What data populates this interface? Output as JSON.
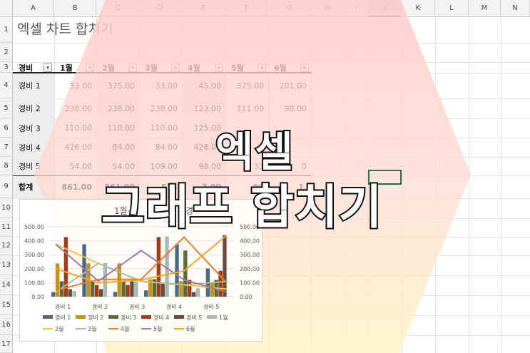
{
  "app": {
    "title": "엑셀 차트 합치기"
  },
  "columns": [
    "A",
    "B",
    "C",
    "D",
    "E",
    "F",
    "G",
    "H",
    "I",
    "J",
    "K",
    "L",
    "M",
    "N"
  ],
  "rows": [
    "1",
    "2",
    "3",
    "4",
    "5",
    "6",
    "7",
    "8",
    "9",
    "10",
    "11",
    "12",
    "13",
    "14",
    "15",
    "16",
    "17"
  ],
  "table": {
    "headers": [
      "경비",
      "1월",
      "2월",
      "3월",
      "4월",
      "5월",
      "6월"
    ],
    "rows": [
      {
        "label": "경비 1",
        "values": [
          "33.00",
          "375.00",
          "33.00",
          "45.00",
          "375.00",
          "201.00"
        ]
      },
      {
        "label": "경비 2",
        "values": [
          "238.00",
          "238.00",
          "238.00",
          "123.00",
          "111.00",
          "98.00"
        ]
      },
      {
        "label": "경비 3",
        "values": [
          "110.00",
          "110.00",
          "110.00",
          "125.00",
          "",
          ""
        ]
      },
      {
        "label": "경비 4",
        "values": [
          "426.00",
          "84.00",
          "84.00",
          "426.00",
          "",
          ""
        ]
      },
      {
        "label": "경비 5",
        "values": [
          "54.00",
          "54.00",
          "109.00",
          "98.00",
          "33",
          "0"
        ]
      }
    ],
    "total": {
      "label": "합계",
      "values": [
        "861.00",
        "861.00",
        "574",
        "7.00",
        "00",
        "1,"
      ]
    }
  },
  "overlay": {
    "line1": "엑셀",
    "line2": "그래프 합치기"
  },
  "colors": {
    "hex_top": "#ffd6d6",
    "hex_bottom": "#fff3c8",
    "excel_green": "#217346"
  },
  "chart_data": {
    "type": "bar",
    "title": "1월~",
    "title_partial": "경",
    "categories": [
      "경비 1",
      "경비 2",
      "경비 3",
      "경비 4",
      "경비 5"
    ],
    "ylim": [
      0,
      500
    ],
    "yticks_left": [
      "500.00",
      "400.00",
      "300.00",
      "200.00",
      "100.00",
      "0.00"
    ],
    "yticks_right": [
      "500.00",
      "400.00",
      "300.00",
      "200.00",
      "100.00",
      "0.00"
    ],
    "bar_series": [
      {
        "name": "경비 1",
        "color": "#4a6b82",
        "values": [
          33,
          375,
          33,
          45,
          375,
          201
        ]
      },
      {
        "name": "경비 2",
        "color": "#c69214",
        "values": [
          238,
          238,
          238,
          123,
          111,
          98
        ]
      },
      {
        "name": "경비 3",
        "color": "#5b6b3d",
        "values": [
          110,
          110,
          110,
          125,
          330,
          120
        ]
      },
      {
        "name": "경비 4",
        "color": "#a33e14",
        "values": [
          426,
          84,
          84,
          426,
          120,
          185
        ]
      },
      {
        "name": "경비 5",
        "color": "#6b4a40",
        "values": [
          54,
          54,
          109,
          98,
          33,
          440
        ]
      },
      {
        "name": "1월",
        "color": "#a6b9b2",
        "values": [
          40,
          240,
          110,
          430,
          60,
          0
        ]
      }
    ],
    "line_series": [
      {
        "name": "2월",
        "color": "#f4c542",
        "values": [
          375,
          238,
          110,
          84,
          54
        ]
      },
      {
        "name": "3월",
        "color": "#a9c09c",
        "values": [
          33,
          238,
          110,
          84,
          109
        ]
      },
      {
        "name": "4월",
        "color": "#f07b2c",
        "values": [
          45,
          123,
          125,
          426,
          98
        ]
      },
      {
        "name": "5월",
        "color": "#a178a8",
        "values": [
          375,
          111,
          330,
          120,
          33
        ]
      },
      {
        "name": "6월",
        "color": "#f5a623",
        "values": [
          201,
          98,
          120,
          185,
          440
        ]
      }
    ],
    "legend": [
      "경비 1",
      "경비 2",
      "경비 3",
      "경비 4",
      "경비 5",
      "1월",
      "2월",
      "3월",
      "4월",
      "5월",
      "6월"
    ]
  }
}
